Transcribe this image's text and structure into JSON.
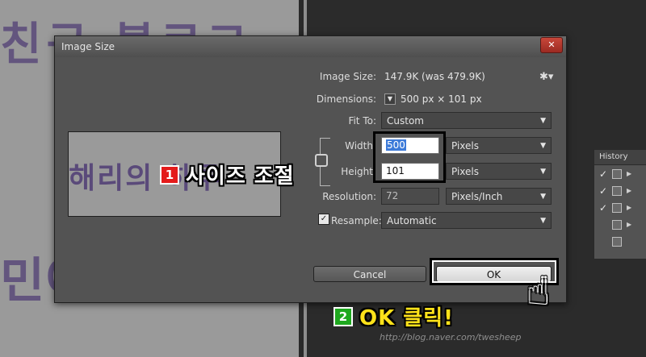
{
  "background": {
    "left_text_top": "친구 블로그",
    "left_text_bottom": "민이",
    "watermark": "http://blog.naver.com/twesheep"
  },
  "history_panel": {
    "title": "History"
  },
  "dialog": {
    "title": "Image Size",
    "close_symbol": "✕",
    "preview_text": "해리의 하루",
    "gear_icon": "✱▾",
    "image_size_label": "Image Size:",
    "image_size_value": "147.9K (was 479.9K)",
    "dimensions_label": "Dimensions:",
    "dimensions_value": "500 px  ×  101 px",
    "fit_to_label": "Fit To:",
    "fit_to_value": "Custom",
    "width_label": "Width:",
    "width_value": "500",
    "width_unit": "Pixels",
    "height_label": "Height:",
    "height_value": "101",
    "height_unit": "Pixels",
    "resolution_label": "Resolution:",
    "resolution_value": "72",
    "resolution_unit": "Pixels/Inch",
    "resample_label": "Resample:",
    "resample_value": "Automatic",
    "resample_checked": "✓",
    "cancel_label": "Cancel",
    "ok_label": "OK",
    "caret": "▼"
  },
  "annotations": {
    "step1_number": "1",
    "step1_text": "사이즈 조절",
    "step2_number": "2",
    "step2_text": "OK 클릭!"
  },
  "colors": {
    "dialog_bg": "#535353",
    "step1_badge": "#e41b1b",
    "step2_badge": "#1fa81f",
    "step2_text": "#ffe21a"
  }
}
